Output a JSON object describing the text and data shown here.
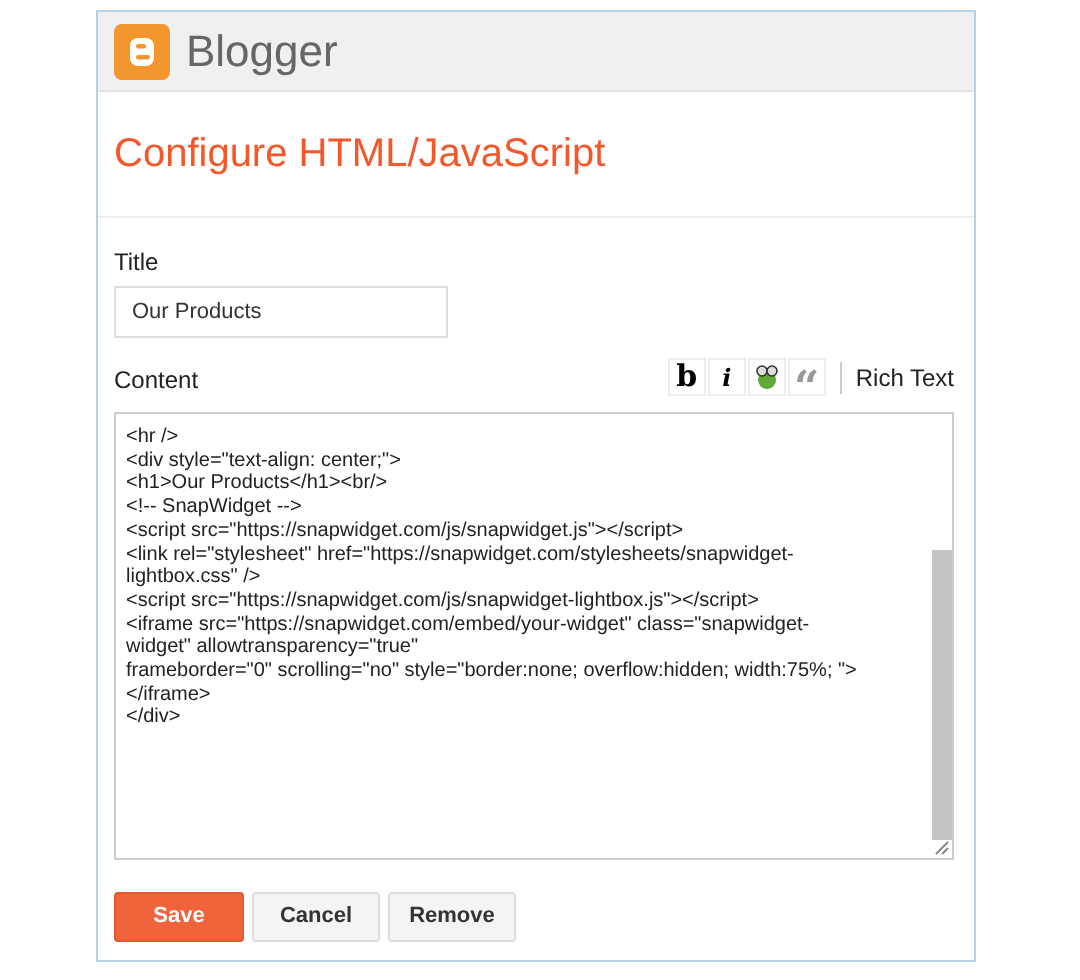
{
  "header": {
    "brand": "Blogger"
  },
  "heading": "Configure HTML/JavaScript",
  "title_field": {
    "label": "Title",
    "value": "Our Products"
  },
  "content": {
    "label": "Content",
    "toolbar": [
      {
        "kind": "bold",
        "label": "b"
      },
      {
        "kind": "italic",
        "label": "i"
      },
      {
        "kind": "image"
      },
      {
        "kind": "quote",
        "label": "“"
      }
    ],
    "rich_text_link": "Rich Text",
    "lines": [
      "<hr />",
      "<div style=\"text-align: center;\">",
      "<h1>Our Products</h1><br/>",
      "<!-- SnapWidget -->",
      "<script src=\"https://snapwidget.com/js/snapwidget.js\"></script>",
      "<link rel=\"stylesheet\" href=\"https://snapwidget.com/stylesheets/snapwidget-",
      "lightbox.css\" />",
      "<script src=\"https://snapwidget.com/js/snapwidget-lightbox.js\"></script>",
      "<iframe src=\"https://snapwidget.com/embed/your-widget\" class=\"snapwidget-",
      "widget\" allowtransparency=\"true\"",
      "frameborder=\"0\" scrolling=\"no\" style=\"border:none; overflow:hidden; width:75%; \">",
      "</iframe>",
      "</div>"
    ]
  },
  "buttons": [
    {
      "kind": "primary",
      "label": "Save"
    },
    {
      "kind": "default",
      "label": "Cancel"
    },
    {
      "kind": "default",
      "label": "Remove"
    }
  ]
}
